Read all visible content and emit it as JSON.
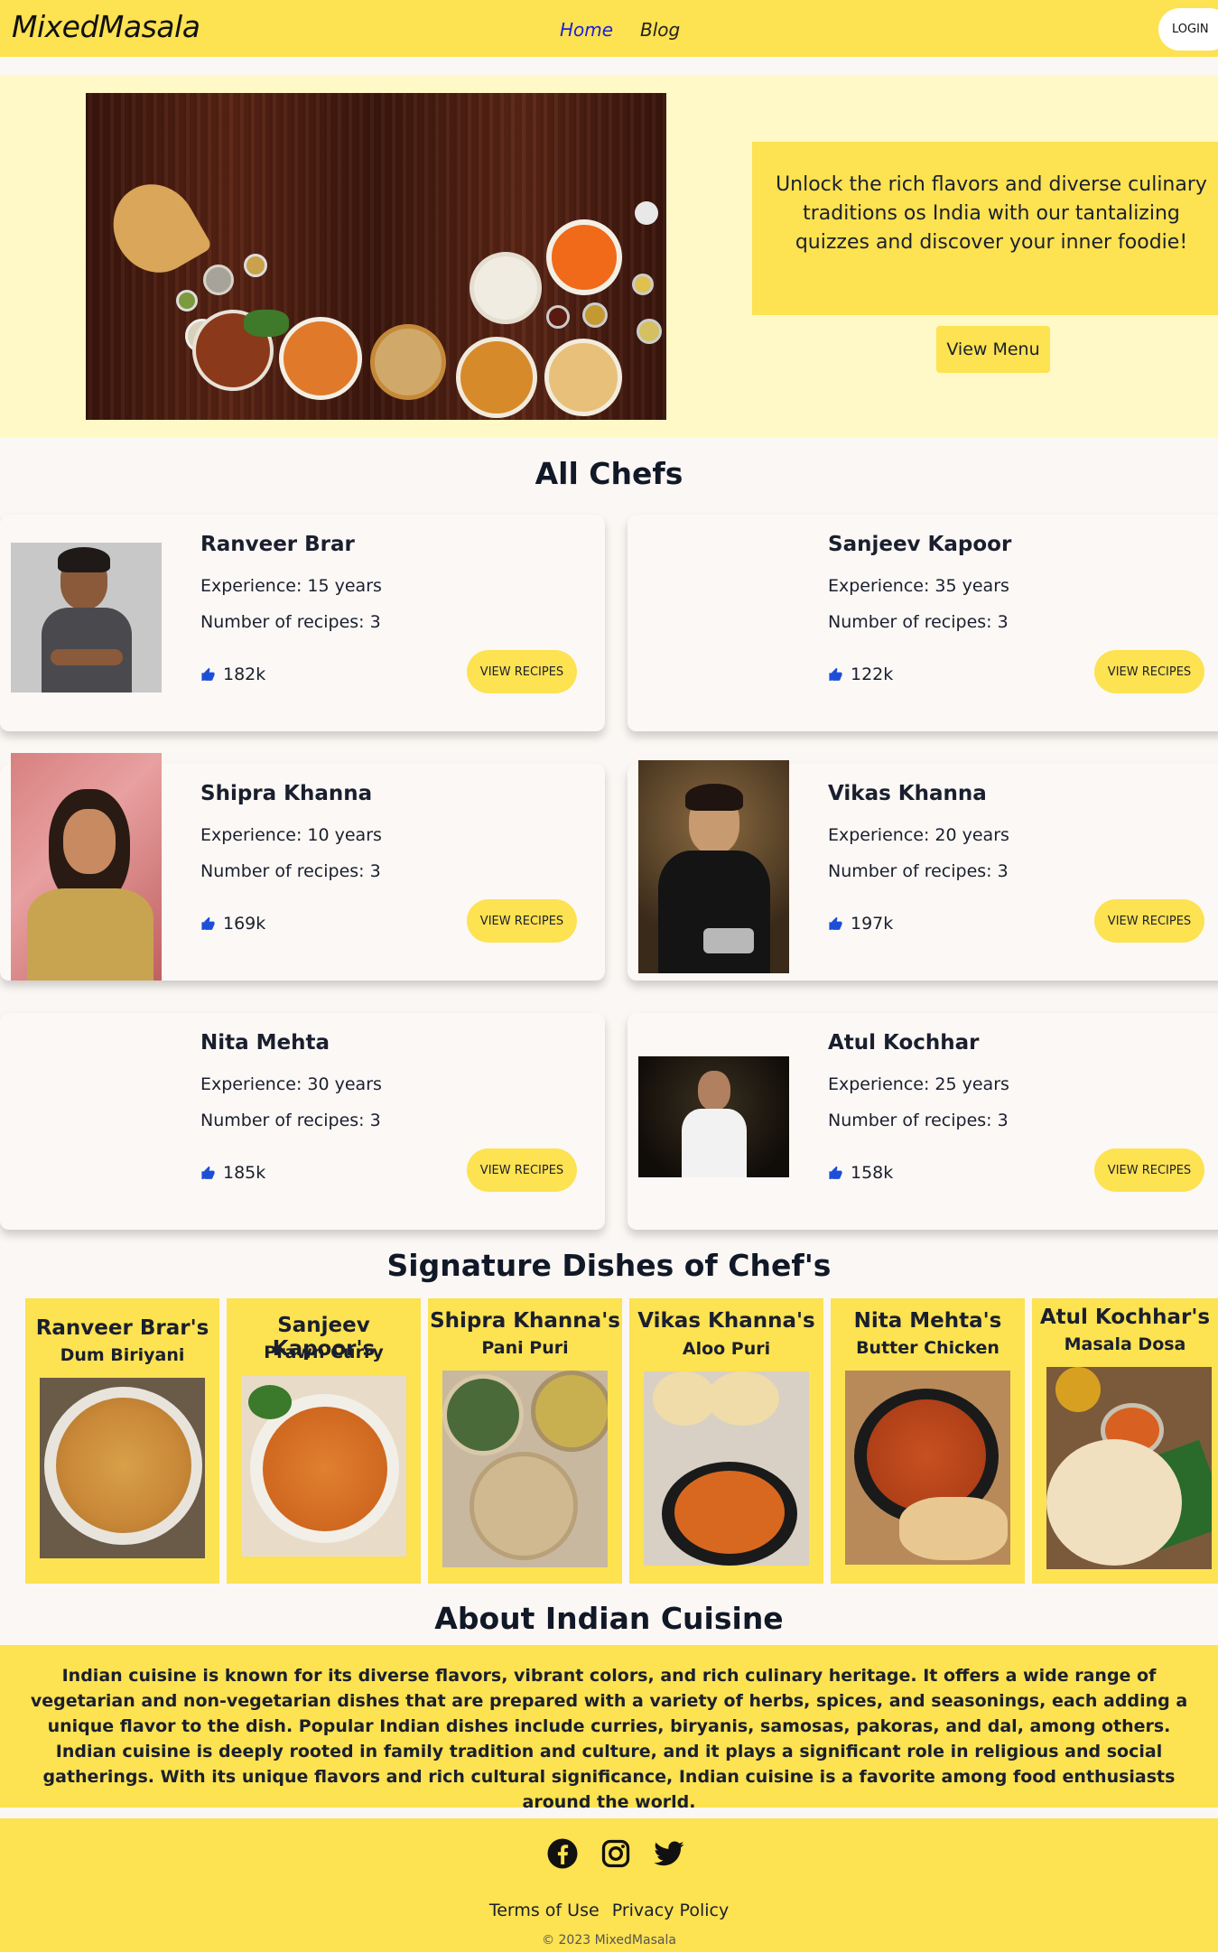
{
  "nav": {
    "brand": "MixedMasala",
    "links": [
      "Home",
      "Blog"
    ],
    "login": "LOGIN"
  },
  "hero": {
    "tagline": "Unlock the rich flavors and diverse culinary traditions os India with our tantalizing quizzes and discover your inner foodie!",
    "button": "View Menu"
  },
  "chefs_section": {
    "title": "All Chefs",
    "chefs": [
      {
        "name": "Ranveer Brar",
        "experience": "Experience: 15 years",
        "recipes": "Number of recipes: 3",
        "likes": "182k",
        "button": "VIEW RECIPES"
      },
      {
        "name": "Sanjeev Kapoor",
        "experience": "Experience: 35 years",
        "recipes": "Number of recipes: 3",
        "likes": "122k",
        "button": "VIEW RECIPES"
      },
      {
        "name": "Shipra Khanna",
        "experience": "Experience: 10 years",
        "recipes": "Number of recipes: 3",
        "likes": "169k",
        "button": "VIEW RECIPES"
      },
      {
        "name": "Vikas Khanna",
        "experience": "Experience: 20 years",
        "recipes": "Number of recipes: 3",
        "likes": "197k",
        "button": "VIEW RECIPES"
      },
      {
        "name": "Nita Mehta",
        "experience": "Experience: 30 years",
        "recipes": "Number of recipes: 3",
        "likes": "185k",
        "button": "VIEW RECIPES"
      },
      {
        "name": "Atul Kochhar",
        "experience": "Experience: 25 years",
        "recipes": "Number of recipes: 3",
        "likes": "158k",
        "button": "VIEW RECIPES"
      }
    ]
  },
  "dishes_section": {
    "title": "Signature Dishes of Chef's",
    "dishes": [
      {
        "chef": "Ranveer Brar's",
        "dish": "Dum Biriyani"
      },
      {
        "chef": "Sanjeev Kapoor's",
        "dish": "Prawn Curry"
      },
      {
        "chef": "Shipra Khanna's",
        "dish": "Pani Puri"
      },
      {
        "chef": "Vikas Khanna's",
        "dish": "Aloo Puri"
      },
      {
        "chef": "Nita Mehta's",
        "dish": "Butter Chicken"
      },
      {
        "chef": "Atul Kochhar's",
        "dish": "Masala Dosa"
      }
    ]
  },
  "about": {
    "title": "About Indian Cuisine",
    "text": "Indian cuisine is known for its diverse flavors, vibrant colors, and rich culinary heritage. It offers a wide range of vegetarian and non-vegetarian dishes that are prepared with a variety of herbs, spices, and seasonings, each adding a unique flavor to the dish. Popular Indian dishes include curries, biryanis, samosas, pakoras, and dal, among others. Indian cuisine is deeply rooted in family tradition and culture, and it plays a significant role in religious and social gatherings. With its unique flavors and rich cultural significance, Indian cuisine is a favorite among food enthusiasts around the world."
  },
  "footer": {
    "social_icons": [
      "facebook-icon",
      "instagram-icon",
      "twitter-icon"
    ],
    "links": [
      "Terms of Use",
      "Privacy Policy"
    ],
    "copyright": "© 2023 MixedMasala"
  },
  "colors": {
    "accent_yellow": "#fde251",
    "hero_bg": "#fff8c7",
    "page_bg": "#fbf7f4",
    "active_link": "#1a22d8",
    "like_icon": "#1d4ed8"
  }
}
